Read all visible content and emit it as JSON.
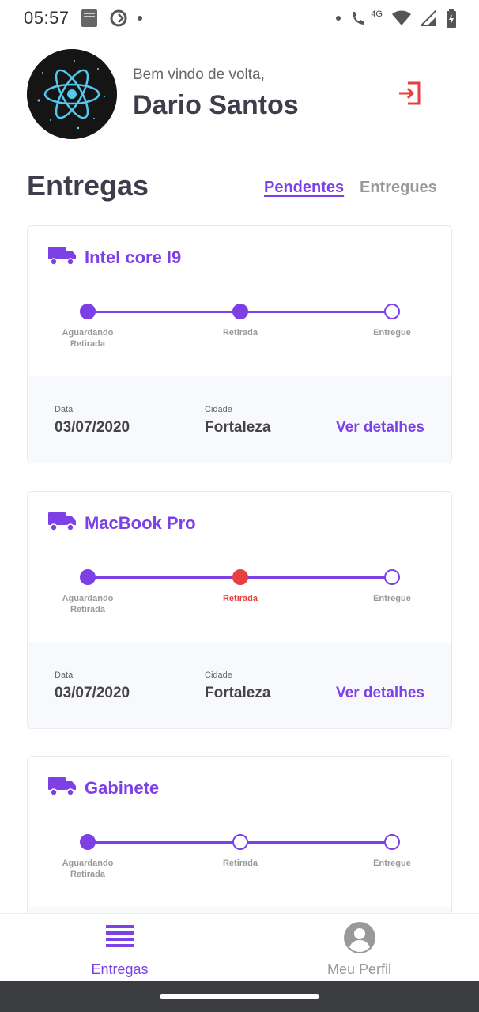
{
  "status_bar": {
    "time": "05:57",
    "network": "4G"
  },
  "header": {
    "greeting": "Bem vindo de volta,",
    "user_name": "Dario Santos"
  },
  "section": {
    "title": "Entregas",
    "tabs": [
      {
        "label": "Pendentes",
        "active": true
      },
      {
        "label": "Entregues",
        "active": false
      }
    ]
  },
  "steps": [
    "Aguardando Retirada",
    "Retirada",
    "Entregue"
  ],
  "info_labels": {
    "date": "Data",
    "city": "Cidade"
  },
  "details_label": "Ver detalhes",
  "deliveries": [
    {
      "product": "Intel core I9",
      "step_states": [
        "done",
        "done",
        "open"
      ],
      "date": "03/07/2020",
      "city": "Fortaleza"
    },
    {
      "product": "MacBook Pro",
      "step_states": [
        "done",
        "problem",
        "open"
      ],
      "date": "03/07/2020",
      "city": "Fortaleza"
    },
    {
      "product": "Gabinete",
      "step_states": [
        "done",
        "open",
        "open"
      ],
      "date": "",
      "city": ""
    }
  ],
  "bottom_nav": [
    {
      "label": "Entregas",
      "icon": "list-icon",
      "active": true
    },
    {
      "label": "Meu Perfil",
      "icon": "user-circle-icon",
      "active": false
    }
  ],
  "colors": {
    "accent": "#7d40e7",
    "alert": "#e74040",
    "card_footer": "#f8f9fd"
  }
}
